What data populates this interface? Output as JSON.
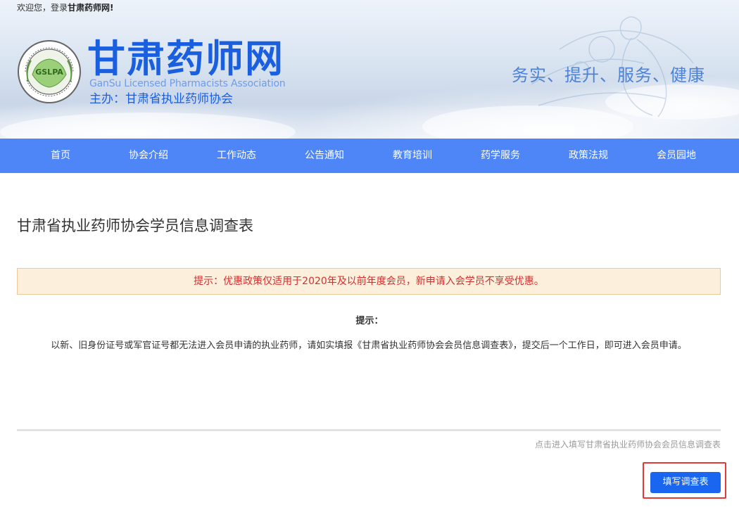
{
  "header": {
    "welcome_prefix": "欢迎您，登录",
    "welcome_site": "甘肃药师网!",
    "site_title": "甘肃药师网",
    "subtitle_en": "GanSu Licensed Pharmacists Association",
    "sponsor": "主办：甘肃省执业药师协会",
    "slogan": "务实、提升、服务、健康",
    "emblem_text": "GSLPA",
    "brand_color": "#1a5fe0"
  },
  "nav": {
    "background": "#4f86f7",
    "items": [
      {
        "label": "首页"
      },
      {
        "label": "协会介绍"
      },
      {
        "label": "工作动态"
      },
      {
        "label": "公告通知"
      },
      {
        "label": "教育培训"
      },
      {
        "label": "药学服务"
      },
      {
        "label": "政策法规"
      },
      {
        "label": "会员园地"
      }
    ]
  },
  "main": {
    "page_title": "甘肃省执业药师协会学员信息调查表",
    "notice": "提示：优惠政策仅适用于2020年及以前年度会员，新申请入会学员不享受优惠。",
    "tip_label": "提示：",
    "tip_text": "以新、旧身份证号或军官证号都无法进入会员申请的执业药师，请如实填报《甘肃省执业药师协会会员信息调查表》，提交后一个工作日，即可进入会员申请。",
    "hint_link": "点击进入填写甘肃省执业药师协会会员信息调查表",
    "fill_button": "填写调查表",
    "button_color": "#1a66f0",
    "highlight_color": "#e53935"
  }
}
